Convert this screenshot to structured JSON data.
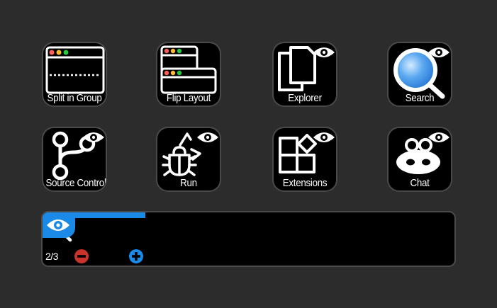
{
  "tiles": [
    {
      "id": "split",
      "label": "Split in Group",
      "icon": "split-window-icon"
    },
    {
      "id": "flip",
      "label": "Flip Layout",
      "icon": "flip-layout-icon"
    },
    {
      "id": "explorer",
      "label": "Explorer",
      "icon": "files-icon"
    },
    {
      "id": "search",
      "label": "Search",
      "icon": "magnifier-icon"
    },
    {
      "id": "source",
      "label": "Source Control",
      "icon": "git-branch-icon"
    },
    {
      "id": "run",
      "label": "Run",
      "icon": "bug-icon"
    },
    {
      "id": "extensions",
      "label": "Extensions",
      "icon": "extensions-blocks-icon"
    },
    {
      "id": "chat",
      "label": "Chat",
      "icon": "chat-creature-icon"
    }
  ],
  "zoom_strip": {
    "page_counter": "2/3",
    "progress": 0.25,
    "zoom_in_icon": "plus-circle-icon",
    "zoom_out_icon": "minus-circle-icon",
    "lens_icon": "magnifier-icon",
    "badge_icon": "eye-icon"
  },
  "colors": {
    "background": "#2c2c2c",
    "tile": "#000000",
    "tile_border": "#4a4a4a",
    "accent_blue": "#1a8ae6",
    "zoom_out_red": "#c8332b",
    "traffic_red": "#ff5f57",
    "traffic_yellow": "#febc2e",
    "traffic_green": "#28c840"
  }
}
